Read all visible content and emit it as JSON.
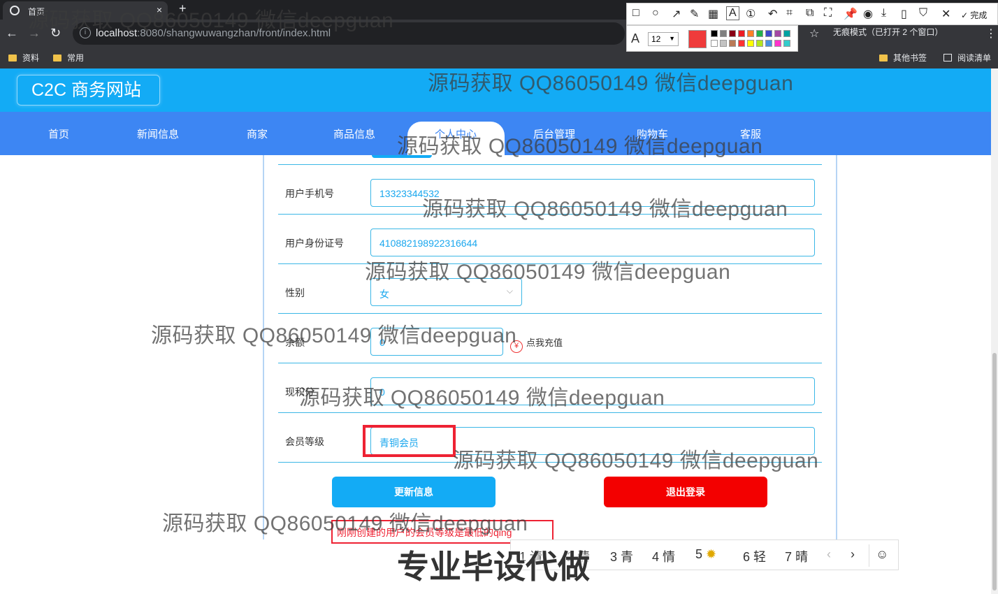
{
  "browser": {
    "tab_title": "首页",
    "tab_close": "×",
    "new_tab": "+",
    "back": "←",
    "forward": "→",
    "reload": "↻",
    "url_host": "localhost",
    "url_rest": ":8080/shangwuwangzhan/front/index.html",
    "incognito_text": "无痕模式（已打开 2 个窗口）",
    "bookmarks": [
      "资料",
      "常用"
    ],
    "bookmarks_right": [
      "其他书签",
      "阅读清单"
    ]
  },
  "screenshot_tool": {
    "font_size": "12",
    "done_label": "完成",
    "colors": [
      "#000000",
      "#7f7f7f",
      "#880015",
      "#ed1c24",
      "#ff7f27",
      "#22b14c",
      "#3f48cc",
      "#a349a4",
      "#00a2a2",
      "#ffffff",
      "#c3c3c3",
      "#b97a57",
      "#ff3333",
      "#ffff00",
      "#b5e61d",
      "#4a90e2",
      "#ff33cc",
      "#33cccc"
    ],
    "selected_color": "#ef3b3b"
  },
  "site": {
    "logo": "C2C 商务网站",
    "nav": [
      "首页",
      "新闻信息",
      "商家",
      "商品信息",
      "个人中心",
      "后台管理",
      "购物车",
      "客服"
    ],
    "active_nav_index": 4
  },
  "form": {
    "phone_label": "用户手机号",
    "phone_value": "13323344532",
    "id_label": "用户身份证号",
    "id_value": "410882198922316644",
    "gender_label": "性别",
    "gender_value": "女",
    "balance_label": "余额",
    "balance_value": "0",
    "recharge_label": "点我充值",
    "points_label": "现积分",
    "points_value": "0",
    "level_label": "会员等级",
    "level_value": "青铜会员",
    "update_button": "更新信息",
    "logout_button": "退出登录"
  },
  "annotation_text": "刚刚创建的用户的会员等级是最低的qing",
  "ime": {
    "candidates": [
      "1 请",
      "2 清",
      "3 青",
      "4 情",
      "5",
      "6 轻",
      "7 晴"
    ]
  },
  "watermark": "源码获取 QQ86050149 微信deepguan",
  "watermark_big": "专业毕设代做",
  "colors": {
    "header": "#13abf5",
    "nav": "#3d86f3",
    "update_button": "#13abf5",
    "logout_button": "#f30000",
    "highlight": "#e22233"
  }
}
